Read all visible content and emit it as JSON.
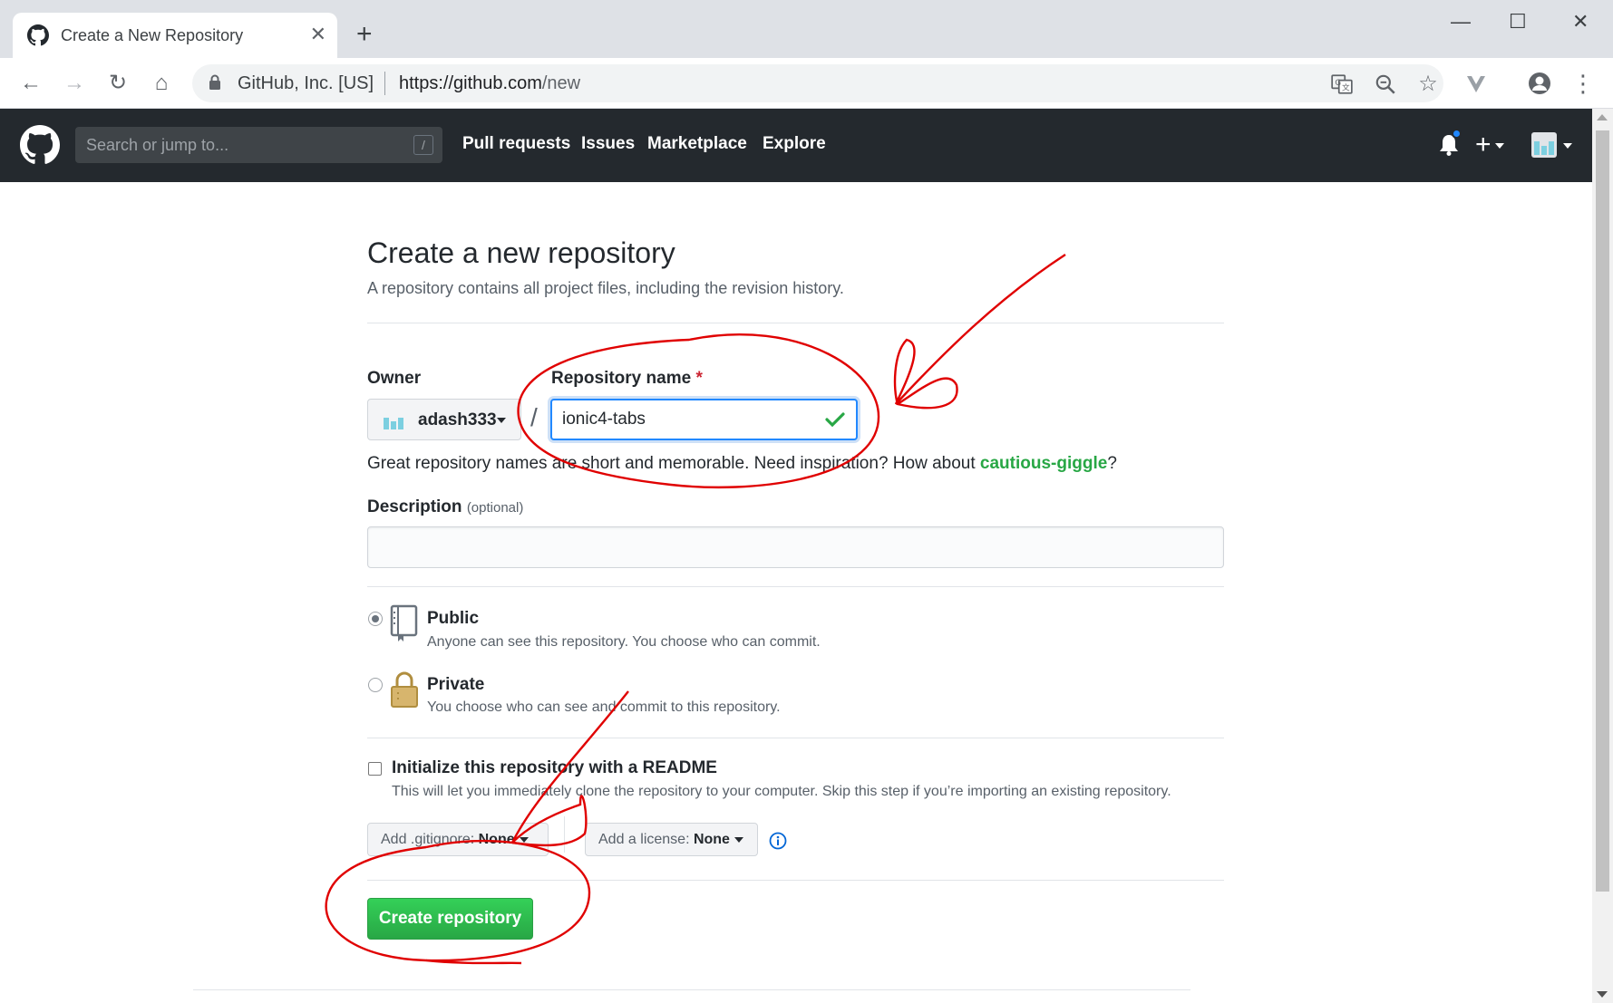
{
  "browser": {
    "tab_title": "Create a New Repository",
    "tab_close": "✕",
    "new_tab": "+",
    "window_controls": {
      "minimize": "—",
      "maximize": "☐",
      "close": "✕"
    },
    "nav": {
      "back": "←",
      "forward": "→",
      "reload": "↻",
      "home": "⌂"
    },
    "address": {
      "org": "GitHub, Inc. [US]",
      "url_host": "https://github.com",
      "url_path": "/new"
    },
    "icons": {
      "translate": "translate-icon",
      "zoom": "zoom-icon",
      "bookmark": "☆",
      "extension": "vue-devtools-icon",
      "profile": "profile-icon",
      "menu": "⋮"
    }
  },
  "github": {
    "search_placeholder": "Search or jump to...",
    "search_key": "/",
    "nav": [
      "Pull requests",
      "Issues",
      "Marketplace",
      "Explore"
    ],
    "plus": "+"
  },
  "form": {
    "title": "Create a new repository",
    "subtitle": "A repository contains all project files, including the revision history.",
    "owner_label": "Owner",
    "owner_value": "adash333",
    "separator": "/",
    "repo_label": "Repository name",
    "required_mark": "*",
    "repo_value": "ionic4-tabs",
    "hint_prefix": "Great repository names are short and memorable. Need inspiration? How about ",
    "hint_suggestion": "cautious-giggle",
    "hint_suffix": "?",
    "description_label": "Description",
    "description_optional": "(optional)",
    "description_value": "",
    "visibility": {
      "public_label": "Public",
      "public_note": "Anyone can see this repository. You choose who can commit.",
      "private_label": "Private",
      "private_note": "You choose who can see and commit to this repository.",
      "selected": "public"
    },
    "init_label": "Initialize this repository with a README",
    "init_note": "This will let you immediately clone the repository to your computer. Skip this step if you’re importing an existing repository.",
    "gitignore_prefix": "Add .gitignore: ",
    "gitignore_value": "None",
    "license_prefix": "Add a license: ",
    "license_value": "None",
    "submit_label": "Create repository"
  },
  "colors": {
    "header_bg": "#24292e",
    "primary_green": "#28a745",
    "focus_blue": "#2188ff",
    "annotation_red": "#e00000"
  }
}
